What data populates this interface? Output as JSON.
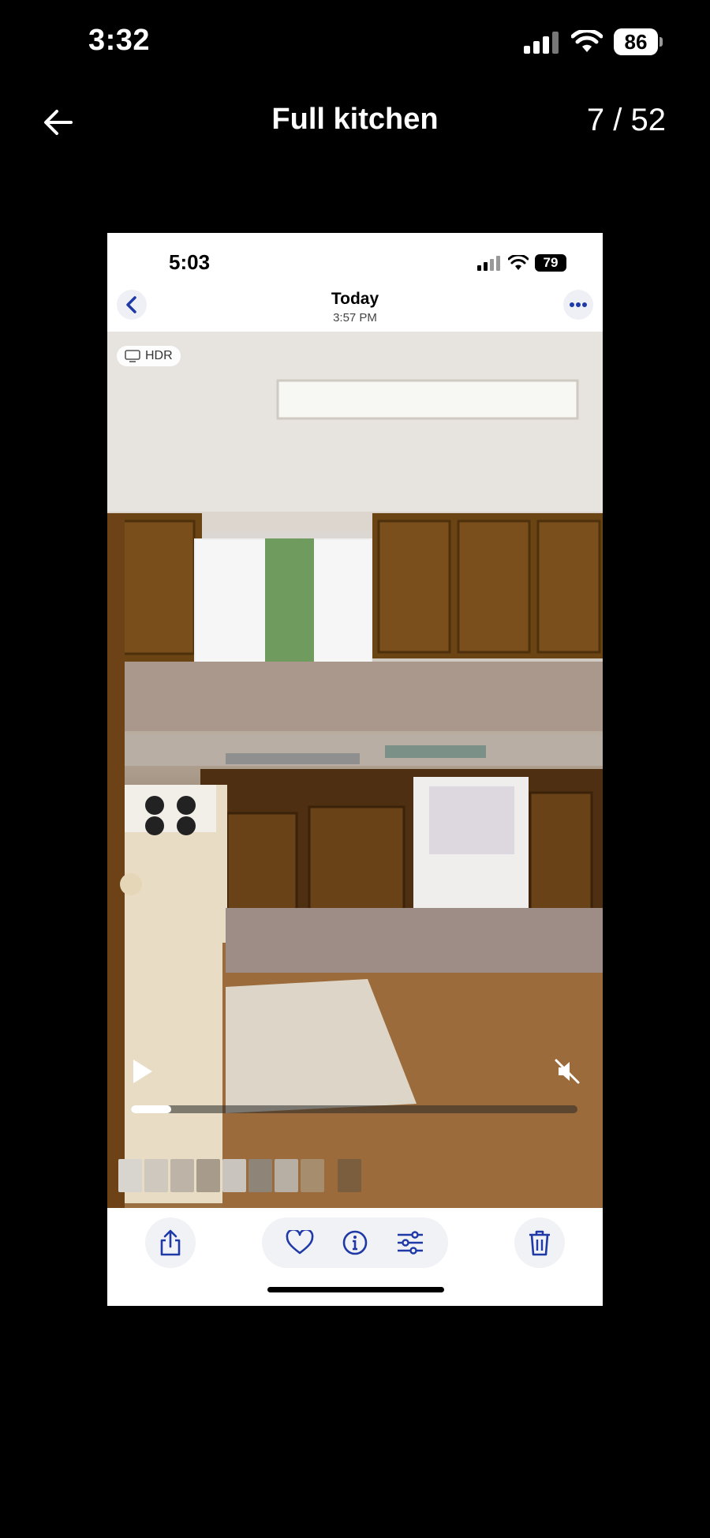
{
  "outer_status": {
    "time": "3:32",
    "battery": "86"
  },
  "header": {
    "title": "Full kitchen",
    "counter": "7 / 52"
  },
  "inner_status": {
    "time": "5:03",
    "battery": "79"
  },
  "inner_header": {
    "title": "Today",
    "subtitle": "3:57 PM"
  },
  "photo": {
    "hdr_label": "HDR",
    "video_progress": 0.09
  },
  "thumbnails": [
    "#d8d4ce",
    "#cfc8bf",
    "#bdb3a6",
    "#a79b8c",
    "#c9c4bd",
    "#8f8478",
    "#b7afa4",
    "#a58d6e",
    "#7a5e3e"
  ],
  "colors": {
    "accent": "#1f3aa6",
    "background": "#000000"
  },
  "icons": [
    "back-arrow-icon",
    "share-icon",
    "heart-icon",
    "info-icon",
    "adjust-icon",
    "trash-icon",
    "play-icon",
    "mute-icon",
    "more-icon"
  ]
}
